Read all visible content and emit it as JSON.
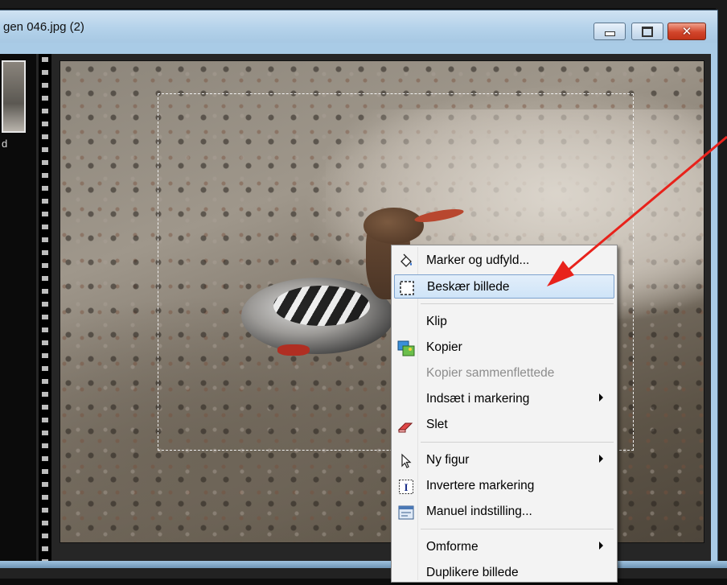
{
  "window": {
    "title": "gen 046.jpg (2)",
    "controls": {
      "minimize": "minimize-icon",
      "maximize": "maximize-icon",
      "close": "close-icon"
    }
  },
  "thumbnail": {
    "label": "d"
  },
  "context_menu": {
    "items": [
      {
        "label": "Marker og udfyld...",
        "icon": "paint-bucket-icon",
        "submenu": false,
        "disabled": false
      },
      {
        "label": "Beskær billede",
        "icon": "crop-icon",
        "submenu": false,
        "disabled": false,
        "highlighted": true
      },
      {
        "label": "Klip",
        "icon": "",
        "submenu": false,
        "disabled": false
      },
      {
        "label": "Kopier",
        "icon": "copy-image-icon",
        "submenu": false,
        "disabled": false
      },
      {
        "label": "Kopier sammenflettede",
        "icon": "",
        "submenu": false,
        "disabled": true
      },
      {
        "label": "Indsæt i markering",
        "icon": "",
        "submenu": true,
        "disabled": false
      },
      {
        "label": "Slet",
        "icon": "eraser-icon",
        "submenu": false,
        "disabled": false
      },
      {
        "label": "Ny figur",
        "icon": "pointer-icon",
        "submenu": true,
        "disabled": false
      },
      {
        "label": "Invertere markering",
        "icon": "invert-selection-icon",
        "submenu": false,
        "disabled": false
      },
      {
        "label": "Manuel indstilling...",
        "icon": "manual-settings-icon",
        "submenu": false,
        "disabled": false
      },
      {
        "label": "Omforme",
        "icon": "",
        "submenu": true,
        "disabled": false
      },
      {
        "label": "Duplikere billede",
        "icon": "",
        "submenu": false,
        "disabled": false
      }
    ]
  },
  "colors": {
    "highlight": "#cfe4f8",
    "annotation_arrow": "#e8221b",
    "title_bar": "#b4d2ea"
  }
}
